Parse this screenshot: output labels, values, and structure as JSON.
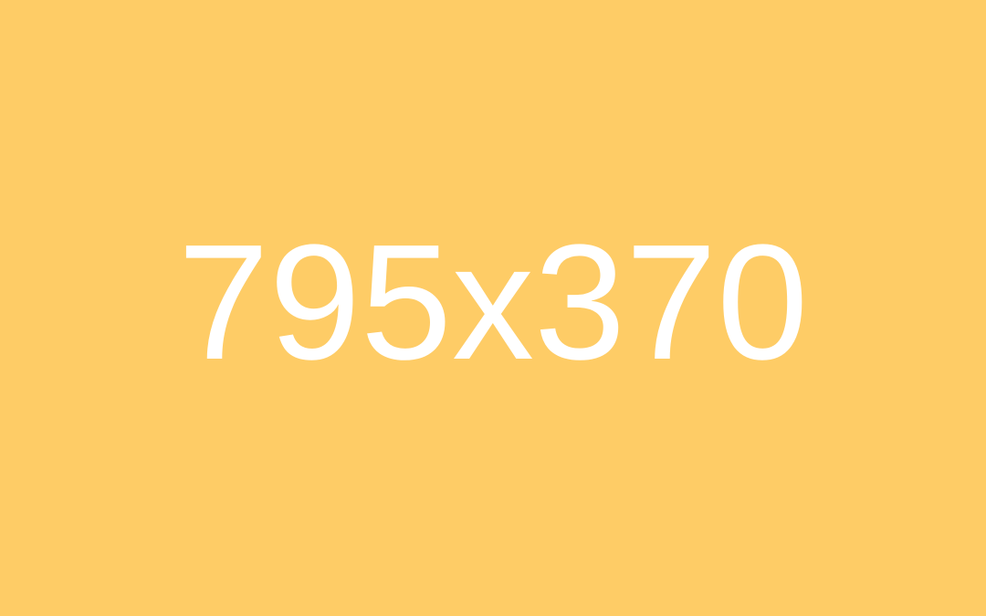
{
  "placeholder": {
    "label": "795x370",
    "background_color": "#FECC66",
    "text_color": "#FFFFFF"
  }
}
